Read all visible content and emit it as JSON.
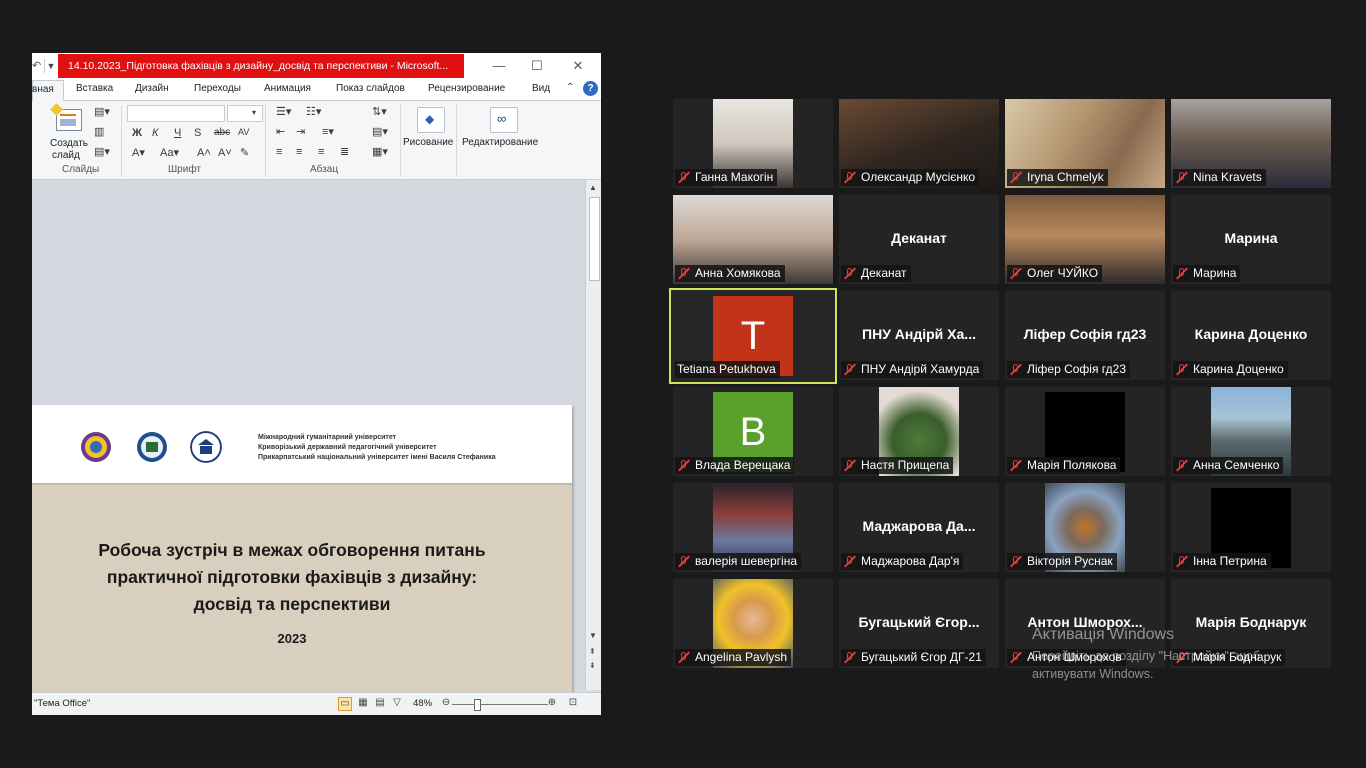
{
  "ppt": {
    "window_title": "14.10.2023_Підготовка фахівців з дизайну_досвід та перспективи  -  Microsoft...",
    "tabs": [
      "вная",
      "Вставка",
      "Дизайн",
      "Переходы",
      "Анимация",
      "Показ слайдов",
      "Рецензирование",
      "Вид"
    ],
    "groups": {
      "slides_label": "Слайды",
      "create_slide": "Создать",
      "create_slide_2": "слайд",
      "font_label": "Шрифт",
      "paragraph_label": "Абзац",
      "drawing": "Рисование",
      "editing": "Редактирование"
    },
    "font_buttons": [
      "Ж",
      "К",
      "Ч",
      "S",
      "abc",
      "AV"
    ],
    "slide": {
      "univ_lines": [
        "Міжнародний гуманітарний університет",
        "Криворізький державний педагогічний університет",
        "Прикарпатський національний університет імені Василя Стефаника"
      ],
      "title_lines": [
        "Робоча зустріч в межах обговорення питань",
        "практичної підготовки фахівців з дизайну:",
        "досвід та перспективи"
      ],
      "year": "2023"
    },
    "status": {
      "theme": "\"Тема Office\"",
      "zoom": "48%"
    }
  },
  "participants": [
    {
      "caption": "Ганна Макогін",
      "type": "video",
      "muted": true
    },
    {
      "caption": "Олександр Мусієнко",
      "type": "video",
      "muted": true
    },
    {
      "caption": "Iryna Chmelyk",
      "type": "video",
      "muted": true
    },
    {
      "caption": "Nina Kravets",
      "type": "video",
      "muted": true
    },
    {
      "caption": "Анна Хомякова",
      "type": "video",
      "muted": true
    },
    {
      "caption": "Деканат",
      "name": "Деканат",
      "type": "name",
      "muted": true
    },
    {
      "caption": "Олег ЧУЙКО",
      "type": "video",
      "muted": true
    },
    {
      "caption": "Марина",
      "name": "Марина",
      "type": "name",
      "muted": true
    },
    {
      "caption": "Tetiana Petukhova",
      "type": "letter",
      "letter": "T",
      "letter_color": "#c1341a",
      "muted": false,
      "active": true
    },
    {
      "caption": "ПНУ Андірй Хамурда",
      "name": "ПНУ  Андірй Ха...",
      "type": "name",
      "muted": true
    },
    {
      "caption": "Ліфер Софія гд23",
      "name": "Ліфер Софія гд23",
      "type": "name",
      "muted": true
    },
    {
      "caption": "Карина Доценко",
      "name": "Карина Доценко",
      "type": "name",
      "muted": true
    },
    {
      "caption": "Влада Верещака",
      "type": "letter",
      "letter": "B",
      "letter_color": "#5aa02c",
      "muted": true
    },
    {
      "caption": "Настя Прищепа",
      "type": "image",
      "muted": true
    },
    {
      "caption": "Марія Полякова",
      "type": "black",
      "muted": true
    },
    {
      "caption": "Анна Семченко",
      "type": "image",
      "muted": true
    },
    {
      "caption": "валерія шевергіна",
      "type": "image",
      "muted": true
    },
    {
      "caption": "Маджарова Дар'я",
      "name": "Маджарова  Да...",
      "type": "name",
      "muted": true
    },
    {
      "caption": "Вікторія Руснак",
      "type": "image",
      "muted": true
    },
    {
      "caption": "Інна Петрина",
      "type": "black",
      "muted": true
    },
    {
      "caption": "Angelina Pavlysh",
      "type": "image",
      "muted": true
    },
    {
      "caption": "Бугацький Єгор ДГ-21",
      "name": "Бугацький  Єгор...",
      "type": "name",
      "muted": true
    },
    {
      "caption": "Антон Шморохов",
      "name": "Антон  Шморох...",
      "type": "name",
      "muted": true
    },
    {
      "caption": "Марія Боднарук",
      "name": "Марія Боднарук",
      "type": "name",
      "muted": true
    }
  ],
  "activation": {
    "title": "Активація Windows",
    "line1": "Перейдіть до розділу \"Настройки\", щоб",
    "line2": "активувати Windows."
  },
  "colors": {
    "active_speaker": "#cde35e",
    "mute": "#e23a3a",
    "title_bar": "#e11010"
  }
}
